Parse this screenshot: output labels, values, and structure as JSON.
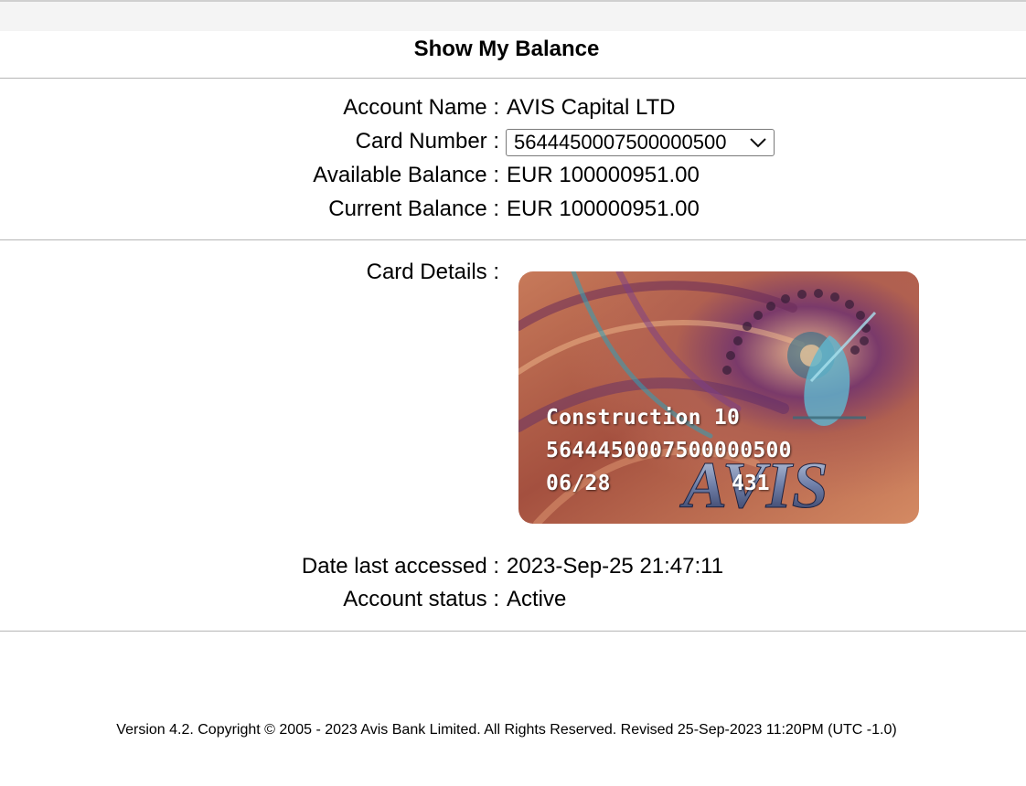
{
  "page": {
    "title": "Show My Balance"
  },
  "balance": {
    "account_name_label": "Account Name :",
    "account_name_value": "AVIS Capital LTD",
    "card_number_label": "Card Number :",
    "card_number_selected": "5644450007500000500",
    "available_balance_label": "Available Balance :",
    "available_balance_value": "EUR 100000951.00",
    "current_balance_label": "Current Balance :",
    "current_balance_value": "EUR 100000951.00"
  },
  "card": {
    "details_label": "Card Details :",
    "holder_line": "Construction 10",
    "number": "5644450007500000500",
    "expiry": "06/28",
    "cvv": "431",
    "brand": "AVIS"
  },
  "status": {
    "last_accessed_label": "Date last accessed :",
    "last_accessed_value": "2023-Sep-25 21:47:11",
    "account_status_label": "Account status :",
    "account_status_value": "Active"
  },
  "footer": {
    "text": "Version 4.2. Copyright © 2005 - 2023 Avis Bank Limited. All Rights Reserved. Revised 25-Sep-2023 11:20PM (UTC -1.0)"
  },
  "colors": {
    "divider": "#b5b5b5",
    "card_base": "#b8644a",
    "card_swirl": "#5a2a6a",
    "card_accent": "#2fa0b8"
  },
  "icons": {
    "select_arrow": "chevron-down-icon"
  }
}
